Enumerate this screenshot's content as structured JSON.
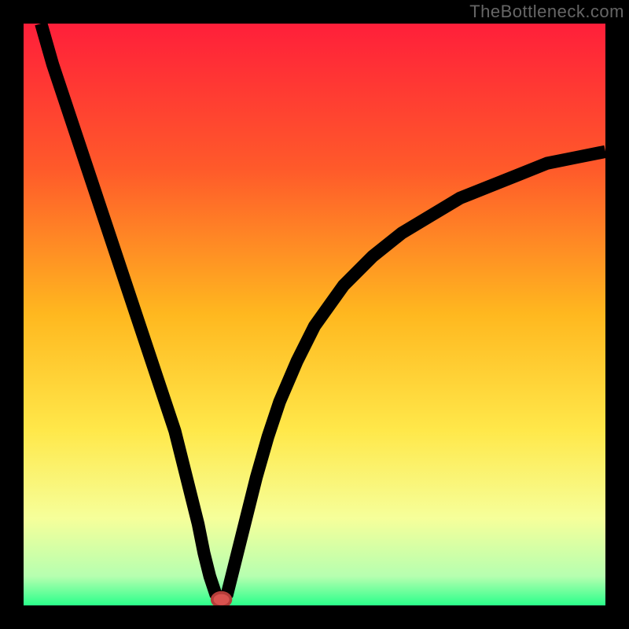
{
  "watermark": "TheBottleneck.com",
  "chart_data": {
    "type": "line",
    "title": "",
    "xlabel": "",
    "ylabel": "",
    "xlim": [
      0,
      100
    ],
    "ylim": [
      0,
      100
    ],
    "grid": false,
    "legend": false,
    "gradient": {
      "stops": [
        {
          "offset": 0.0,
          "color": "#ff1f3a"
        },
        {
          "offset": 0.25,
          "color": "#ff5a2a"
        },
        {
          "offset": 0.5,
          "color": "#ffb81f"
        },
        {
          "offset": 0.7,
          "color": "#ffe84a"
        },
        {
          "offset": 0.85,
          "color": "#f6ff9a"
        },
        {
          "offset": 0.95,
          "color": "#b6ffb0"
        },
        {
          "offset": 1.0,
          "color": "#2aff8a"
        }
      ]
    },
    "series": [
      {
        "name": "curve",
        "x": [
          3,
          5,
          8,
          11,
          14,
          17,
          20,
          23,
          26,
          28,
          30,
          31,
          32,
          33,
          34,
          35,
          36,
          38,
          40,
          42,
          44,
          47,
          50,
          55,
          60,
          65,
          70,
          75,
          80,
          85,
          90,
          95,
          100
        ],
        "y": [
          100,
          93,
          84,
          75,
          66,
          57,
          48,
          39,
          30,
          22,
          14,
          9,
          5,
          2,
          1,
          2,
          6,
          14,
          22,
          29,
          35,
          42,
          48,
          55,
          60,
          64,
          67,
          70,
          72,
          74,
          76,
          77,
          78
        ]
      }
    ],
    "marker": {
      "x": 34,
      "y": 1,
      "rx": 1.6,
      "ry": 1.2,
      "color": "#d9534f"
    }
  }
}
